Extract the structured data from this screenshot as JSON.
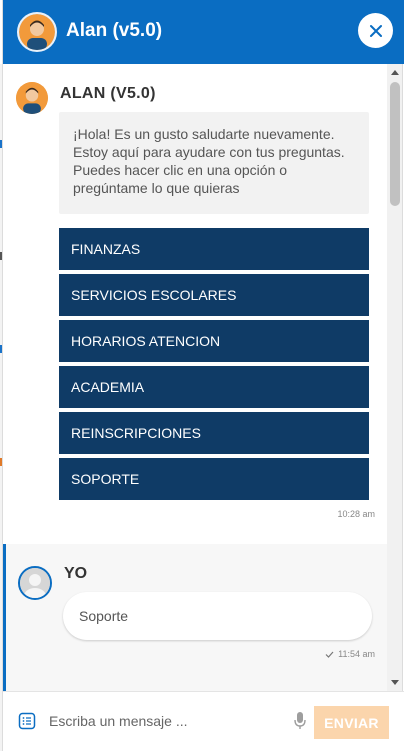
{
  "header": {
    "title": "Alan (v5.0)",
    "avatar_icon": "bot-avatar-icon",
    "close_icon": "close-icon",
    "color": "#0a6dc2"
  },
  "bot_message": {
    "sender": "ALAN (V5.0)",
    "text": "¡Hola! Es un gusto saludarte nuevamente. Estoy aquí para ayudare con tus preguntas. Puedes hacer clic en una opción o pregúntame lo que quieras",
    "time": "10:28 am",
    "options": [
      "FINANZAS",
      "SERVICIOS ESCOLARES",
      "HORARIOS ATENCION",
      "ACADEMIA",
      "REINSCRIPCIONES",
      "SOPORTE"
    ],
    "option_color": "#0f3b66"
  },
  "user_message": {
    "sender": "YO",
    "text": "Soporte",
    "time": "11:54 am",
    "status_icon": "check-icon"
  },
  "composer": {
    "placeholder": "Escriba un mensaje ...",
    "value": "",
    "send_label": "ENVIAR",
    "send_color": "#fbd5ac",
    "menu_icon": "menu-list-icon",
    "mic_icon": "microphone-icon"
  }
}
